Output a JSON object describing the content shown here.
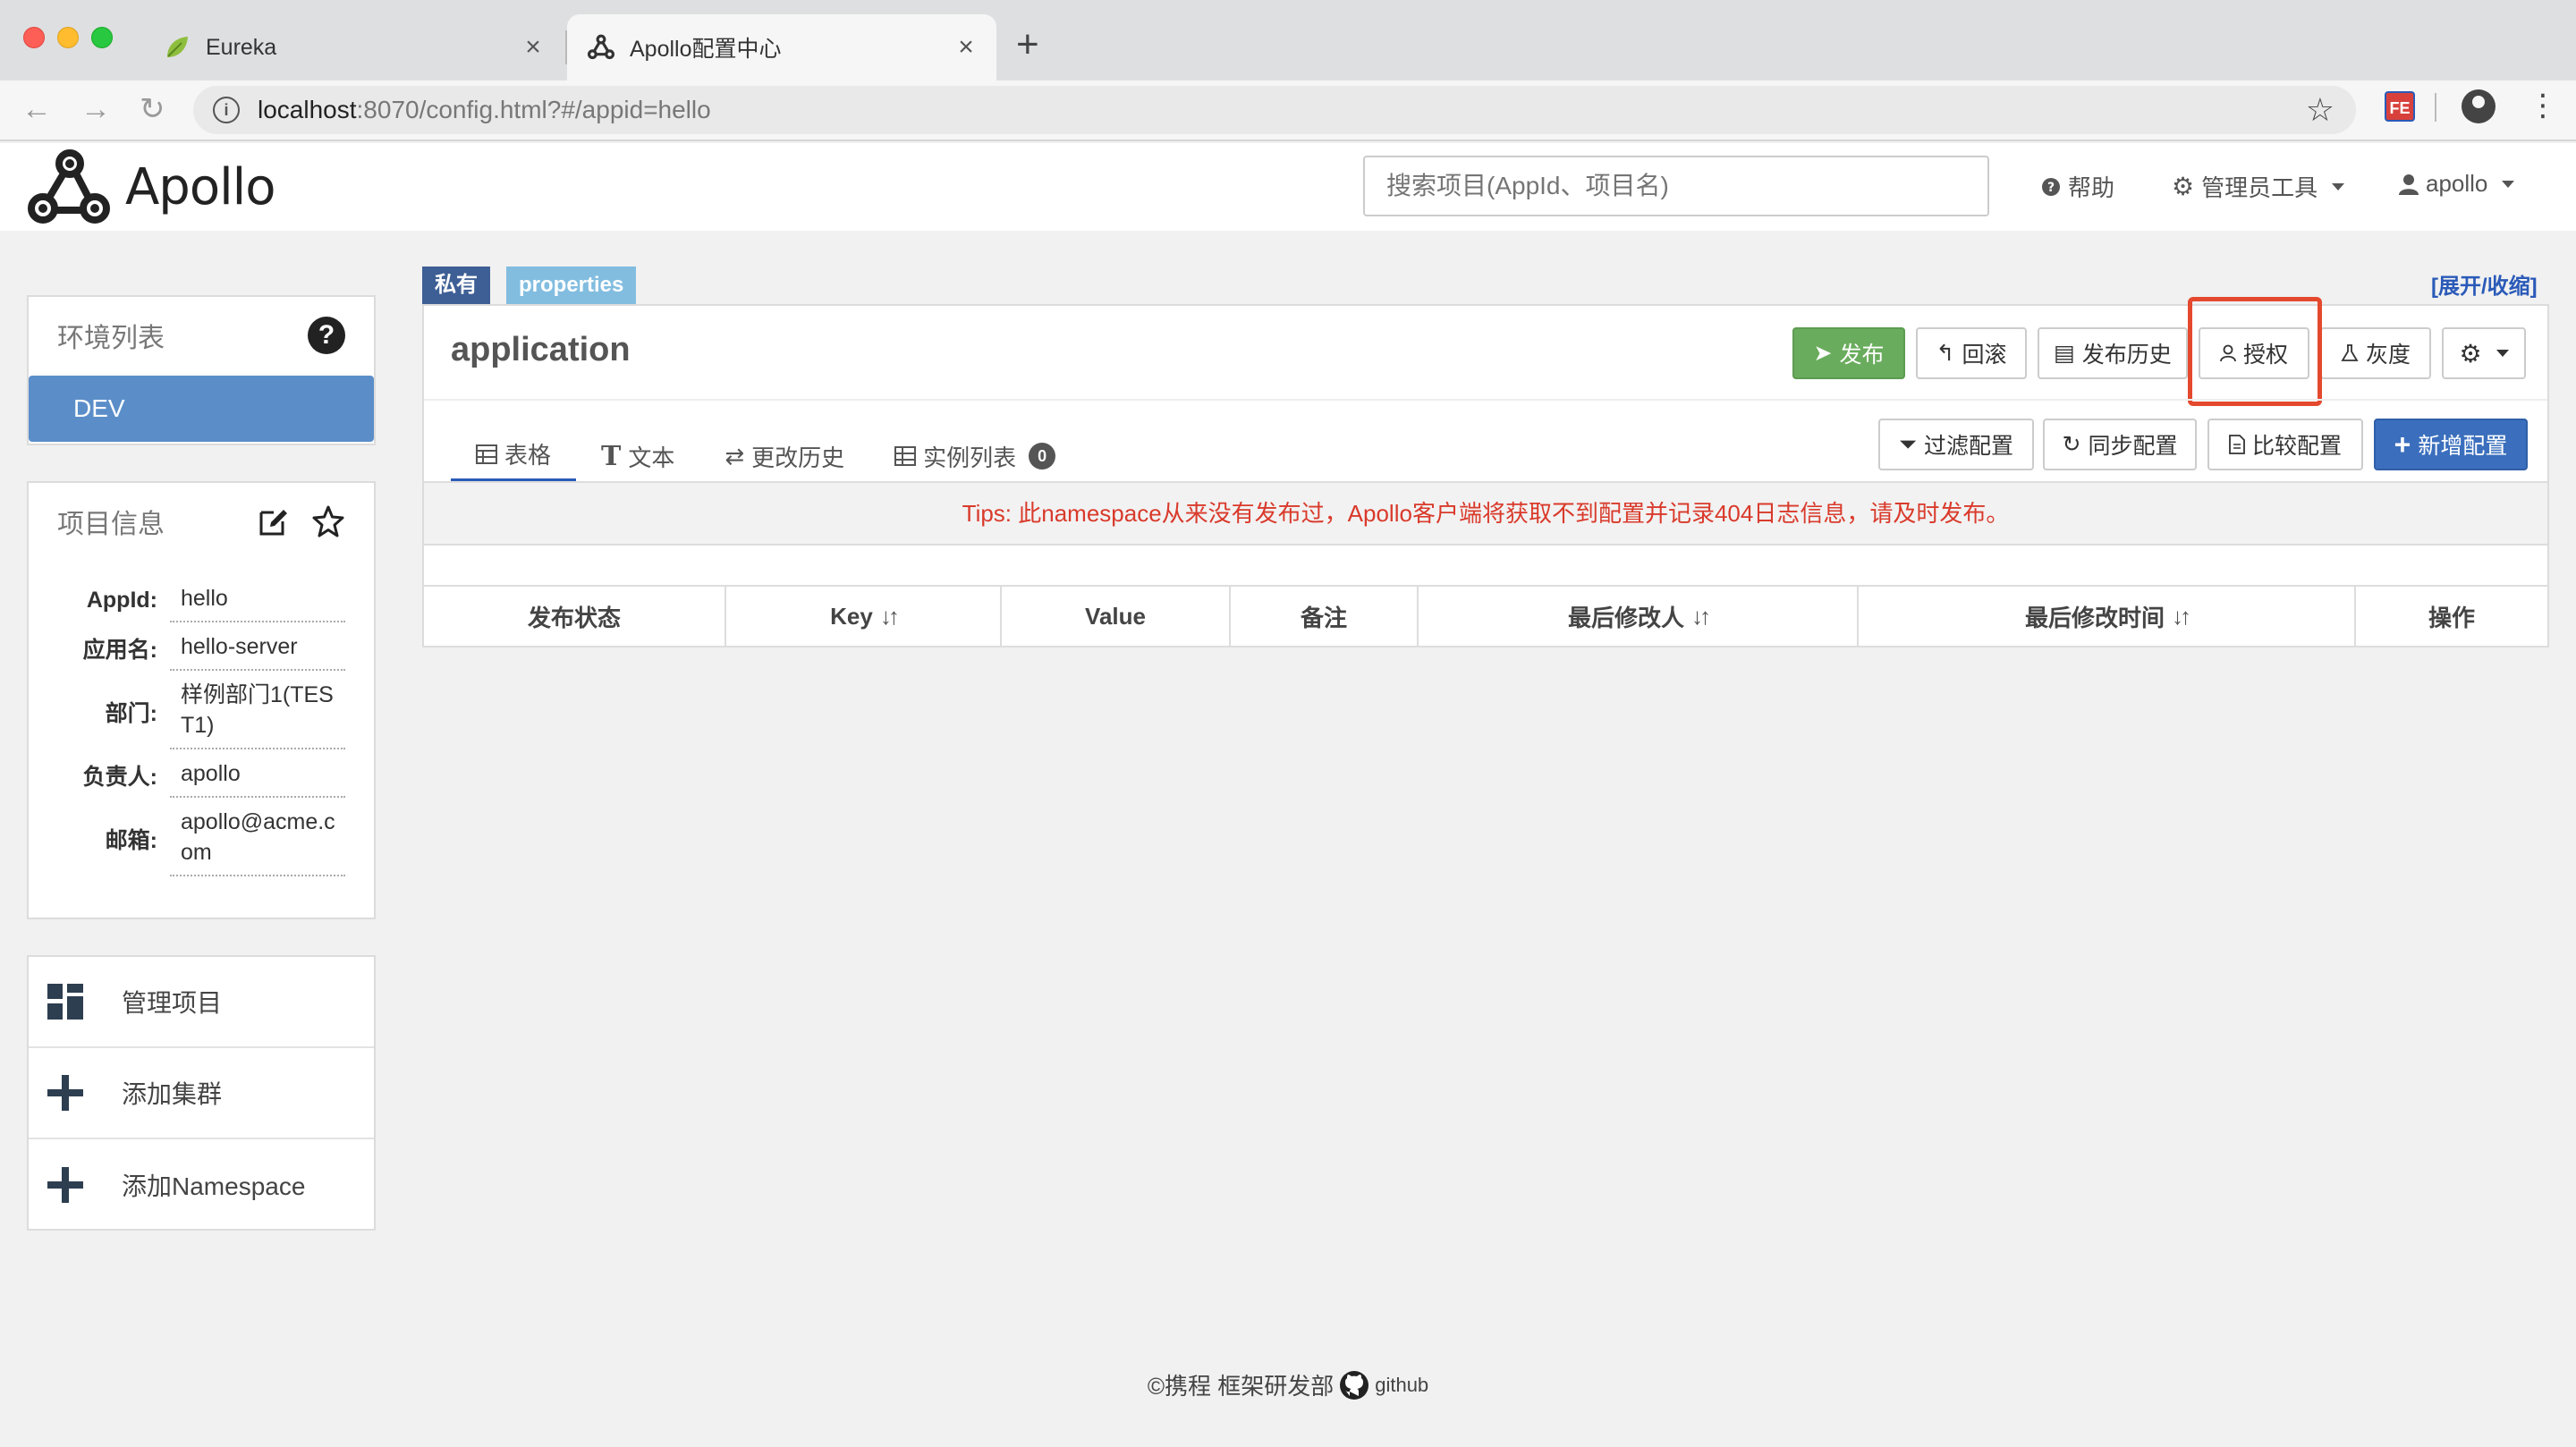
{
  "browser": {
    "tabs": [
      {
        "title": "Eureka"
      },
      {
        "title": "Apollo配置中心"
      }
    ],
    "url_host": "localhost",
    "url_rest": ":8070/config.html?#/appid=hello",
    "ext_label": "FE"
  },
  "header": {
    "logo_text": "Apollo",
    "search_placeholder": "搜索项目(AppId、项目名)",
    "help": "帮助",
    "admin_tools": "管理员工具",
    "user": "apollo"
  },
  "sidebar": {
    "env_title": "环境列表",
    "envs": [
      "DEV"
    ],
    "info_title": "项目信息",
    "info": [
      {
        "label": "AppId:",
        "value": "hello"
      },
      {
        "label": "应用名:",
        "value": "hello-server"
      },
      {
        "label": "部门:",
        "value": "样例部门1(TEST1)"
      },
      {
        "label": "负责人:",
        "value": "apollo"
      },
      {
        "label": "邮箱:",
        "value": "apollo@acme.com"
      }
    ],
    "actions": [
      {
        "label": "管理项目",
        "icon": "dashboard-icon"
      },
      {
        "label": "添加集群",
        "icon": "plus-icon"
      },
      {
        "label": "添加Namespace",
        "icon": "plus-icon"
      }
    ]
  },
  "namespace": {
    "badge_private": "私有",
    "badge_format": "properties",
    "expand_toggle": "[展开/收缩]",
    "title": "application",
    "buttons": {
      "publish": "发布",
      "rollback": "回滚",
      "history": "发布历史",
      "authorize": "授权",
      "gray": "灰度"
    },
    "tabs": {
      "table": "表格",
      "text": "文本",
      "history": "更改历史",
      "instances": "实例列表",
      "instances_count": "0"
    },
    "tools": {
      "filter": "过滤配置",
      "sync": "同步配置",
      "compare": "比较配置",
      "add": "新增配置"
    },
    "tips": "Tips: 此namespace从来没有发布过，Apollo客户端将获取不到配置并记录404日志信息，请及时发布。",
    "columns": [
      "发布状态",
      "Key",
      "Value",
      "备注",
      "最后修改人",
      "最后修改时间",
      "操作"
    ]
  },
  "footer": {
    "copyright": "©携程 框架研发部",
    "github": "github"
  },
  "colors": {
    "accent": "#2a5ab8",
    "env_selected": "#5b8ec9",
    "publish_green": "#6aac5d",
    "add_blue": "#3b6fbd",
    "tips_red": "#d93a2b",
    "highlight_red": "#e4492e"
  }
}
